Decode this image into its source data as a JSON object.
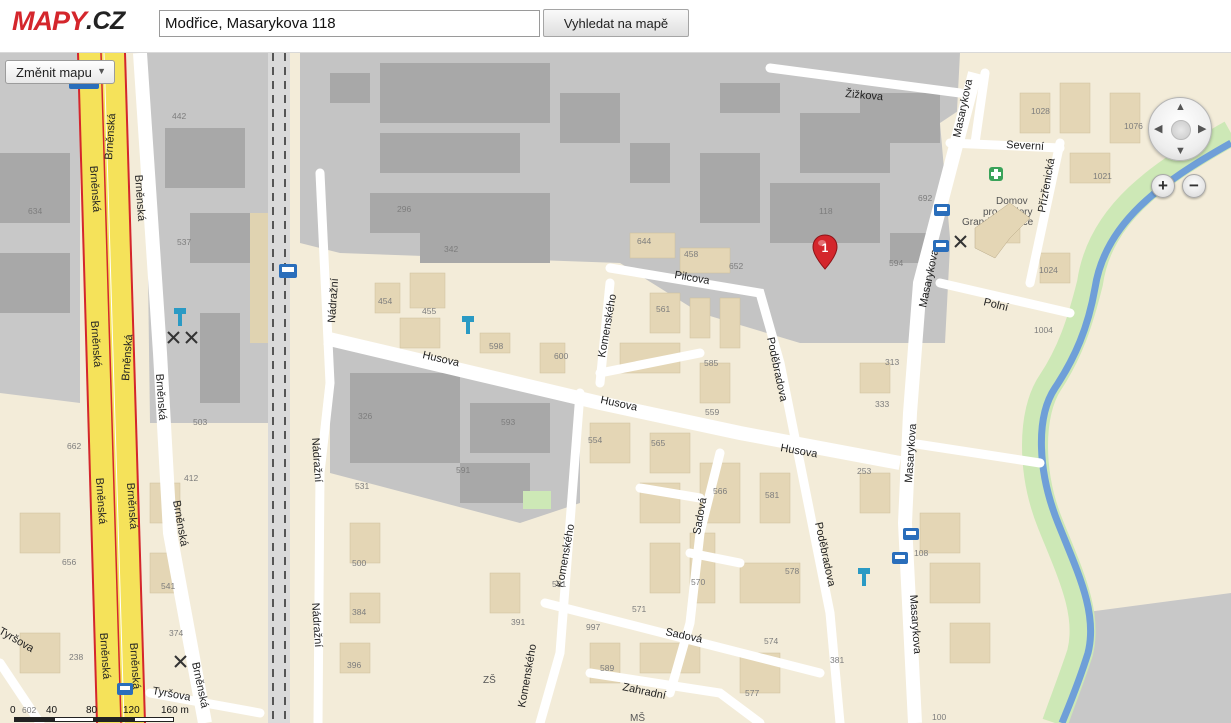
{
  "logo": {
    "text_main": "MAPY",
    "text_rest": ".CZ"
  },
  "search": {
    "value": "Modřice, Masarykova 118",
    "button_label": "Vyhledat na mapě"
  },
  "map_type_button": {
    "label": "Změnit mapu",
    "caret": "▼"
  },
  "zoom": {
    "in_label": "+",
    "out_label": "−"
  },
  "pan": {
    "up": "▲",
    "down": "▼",
    "left": "◀",
    "right": "▶"
  },
  "marker": {
    "number": "1",
    "color": "#d4262c"
  },
  "scale": {
    "labels": [
      "0",
      "40",
      "80",
      "120",
      "160 m"
    ]
  },
  "colors": {
    "highway": "#f5e25a",
    "highway_edge": "#d4262c",
    "industrial": "#bdbdbd",
    "residential": "#f3ecd9",
    "river": "#6f9fd8",
    "greenbelt": "#cde8b6",
    "road": "#ffffff"
  },
  "map": {
    "streets": [
      "Brněnská",
      "Brněnská",
      "Brněnská",
      "Brněnská",
      "Brněnská",
      "Brněnská",
      "Brněnská",
      "Brněnská",
      "Brněnská",
      "Brněnská",
      "Brněnská",
      "Brněnská",
      "Žižkova",
      "Masarykova",
      "Masarykova",
      "Masarykova",
      "Masarykova",
      "Severní",
      "Přízřenická",
      "Polní",
      "Pilcova",
      "Komenského",
      "Komenského",
      "Komenského",
      "Poděbradova",
      "Poděbradova",
      "Husova",
      "Husova",
      "Husova",
      "Nádražní",
      "Nádražní",
      "Nádražní",
      "Sadová",
      "Sadová",
      "Zahradní",
      "Tyršova",
      "Tyršova"
    ],
    "house_numbers": [
      "442",
      "634",
      "537",
      "296",
      "342",
      "454",
      "455",
      "598",
      "600",
      "644",
      "458",
      "652",
      "561",
      "585",
      "559",
      "554",
      "565",
      "566",
      "581",
      "326",
      "593",
      "591",
      "503",
      "662",
      "412",
      "531",
      "500",
      "384",
      "396",
      "501",
      "391",
      "997",
      "571",
      "570",
      "578",
      "574",
      "589",
      "577",
      "381",
      "108",
      "253",
      "333",
      "313",
      "594",
      "692",
      "1028",
      "1076",
      "1021",
      "1024",
      "1004",
      "656",
      "541",
      "374",
      "238",
      "602",
      "100"
    ],
    "places": [
      "Domov",
      "pro seniory",
      "Grandresidence",
      "ZŠ",
      "MŠ"
    ],
    "marker_house": "118"
  }
}
